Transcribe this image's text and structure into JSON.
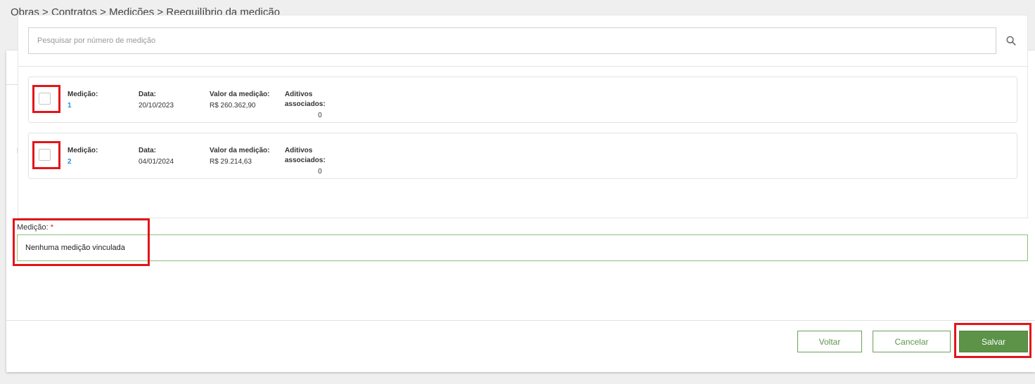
{
  "breadcrumb": "Obras > Contratos > Medições > Reequilíbrio da medição",
  "search": {
    "placeholder": "Pesquisar por número de medição",
    "icon": "search-icon"
  },
  "measurements": [
    {
      "medicao_label": "Medição:",
      "medicao_value": "1",
      "data_label": "Data:",
      "data_value": "20/10/2023",
      "valor_label": "Valor da medição:",
      "valor_value": "R$ 260.362,90",
      "aditivos_label": "Aditivos associados:",
      "aditivos_value": "0",
      "checked": false
    },
    {
      "medicao_label": "Medição:",
      "medicao_value": "2",
      "data_label": "Data:",
      "data_value": "04/01/2024",
      "valor_label": "Valor da medição:",
      "valor_value": "R$ 29.214,63",
      "aditivos_label": "Aditivos associados:",
      "aditivos_value": "0",
      "checked": false
    }
  ],
  "medicao_field": {
    "label": "Medição:",
    "required_mark": "*",
    "value": "Nenhuma medição vinculada"
  },
  "footer": {
    "voltar_label": "Voltar",
    "cancelar_label": "Cancelar",
    "salvar_label": "Salvar"
  },
  "colors": {
    "accent_green": "#5c9348",
    "link_blue": "#1e90e0",
    "highlight_red": "#e3151a"
  }
}
